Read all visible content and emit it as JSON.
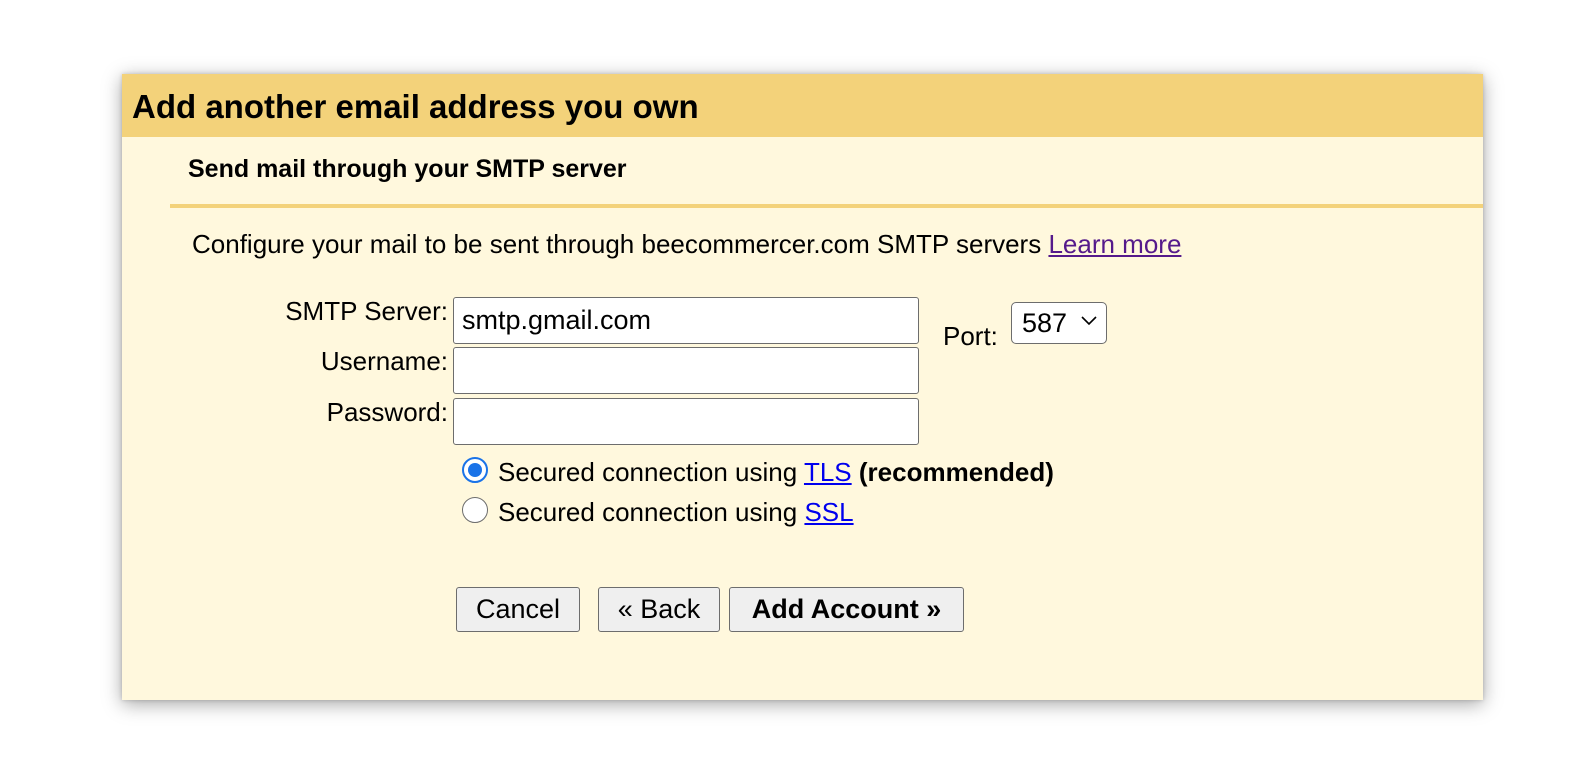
{
  "dialog": {
    "title": "Add another email address you own",
    "section_title": "Send mail through your SMTP server",
    "description": "Configure your mail to be sent through beecommercer.com SMTP servers",
    "learn_more": "Learn more"
  },
  "form": {
    "smtp_server_label": "SMTP Server:",
    "smtp_server_value": "smtp.gmail.com",
    "port_label": "Port:",
    "port_value": "587",
    "username_label": "Username:",
    "username_value": "",
    "password_label": "Password:",
    "password_value": ""
  },
  "security": {
    "tls_prefix": "Secured connection using",
    "tls_link": "TLS",
    "tls_note": "(recommended)",
    "tls_selected": true,
    "ssl_prefix": "Secured connection using",
    "ssl_link": "SSL",
    "ssl_selected": false
  },
  "buttons": {
    "cancel": "Cancel",
    "back": "« Back",
    "add_account": "Add Account »"
  },
  "colors": {
    "header_background": "#f3d27a",
    "body_background": "#fff8dd",
    "radio_selected": "#1a73e8",
    "link_visited": "#551a8b",
    "link": "#0000ee"
  }
}
